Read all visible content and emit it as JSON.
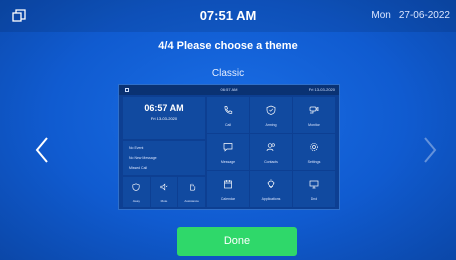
{
  "statusbar": {
    "time": "07:51 AM",
    "day": "Mon",
    "date": "27-06-2022"
  },
  "heading": "4/4 Please choose a theme",
  "theme_name": "Classic",
  "preview": {
    "status_time": "06:57 AM",
    "status_date": "Fri 13-03-2020",
    "clock_time": "06:57 AM",
    "clock_date": "Fri 13-03-2020",
    "lines": [
      "No Event",
      "No New Message",
      "Missed Call"
    ],
    "left_bottom": [
      {
        "label": "Away",
        "icon": "shield-icon"
      },
      {
        "label": "Mute",
        "icon": "speaker-icon"
      },
      {
        "label": "Assistance",
        "icon": "hand-icon"
      }
    ],
    "tiles": [
      {
        "label": "Call",
        "icon": "phone-icon"
      },
      {
        "label": "Arming",
        "icon": "shield-icon"
      },
      {
        "label": "Monitor",
        "icon": "camera-icon"
      },
      {
        "label": "Message",
        "icon": "message-icon"
      },
      {
        "label": "Contacts",
        "icon": "contacts-icon"
      },
      {
        "label": "Settings",
        "icon": "gear-icon"
      },
      {
        "label": "Calendar",
        "icon": "calendar-icon"
      },
      {
        "label": "Applications",
        "icon": "lightbulb-icon"
      },
      {
        "label": "Dnd",
        "icon": "monitor-icon"
      }
    ]
  },
  "done_label": "Done",
  "colors": {
    "background": "#0f56c8",
    "done": "#2fd86a"
  }
}
